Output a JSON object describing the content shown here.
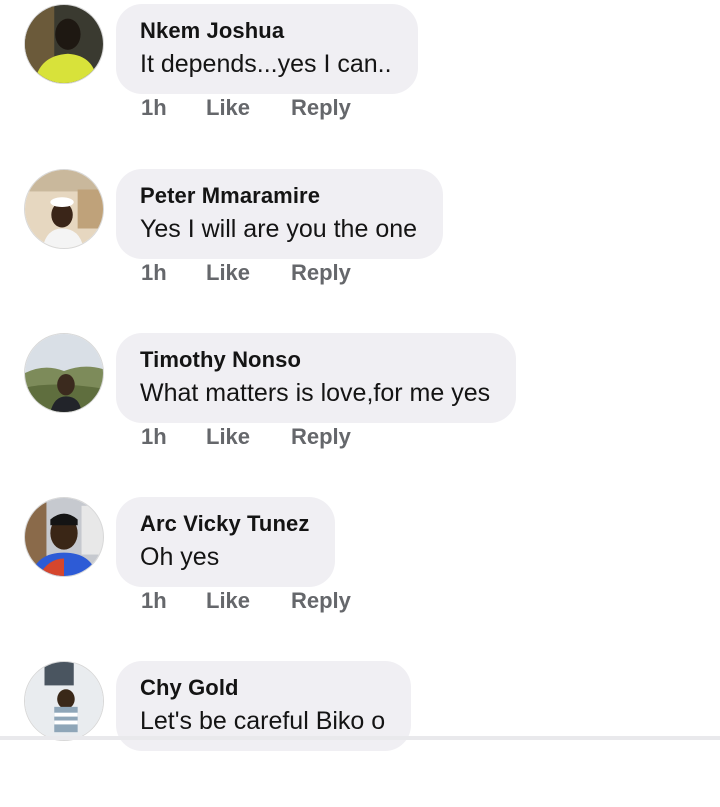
{
  "comments": [
    {
      "name": "Nkem Joshua",
      "text": "It depends...yes I can..",
      "time": "1h",
      "like": "Like",
      "reply": "Reply"
    },
    {
      "name": "Peter Mmaramire",
      "text": "Yes I will are you the one",
      "time": "1h",
      "like": "Like",
      "reply": "Reply"
    },
    {
      "name": "Timothy Nonso",
      "text": "What matters is love,for me yes",
      "time": "1h",
      "like": "Like",
      "reply": "Reply"
    },
    {
      "name": "Arc Vicky Tunez",
      "text": "Oh yes",
      "time": "1h",
      "like": "Like",
      "reply": "Reply"
    },
    {
      "name": "Chy Gold",
      "text": "Let's be careful Biko o",
      "time": "",
      "like": "",
      "reply": ""
    }
  ],
  "colors": {
    "bubble": "#f0eff3",
    "meta": "#65676b",
    "text": "#141414"
  }
}
